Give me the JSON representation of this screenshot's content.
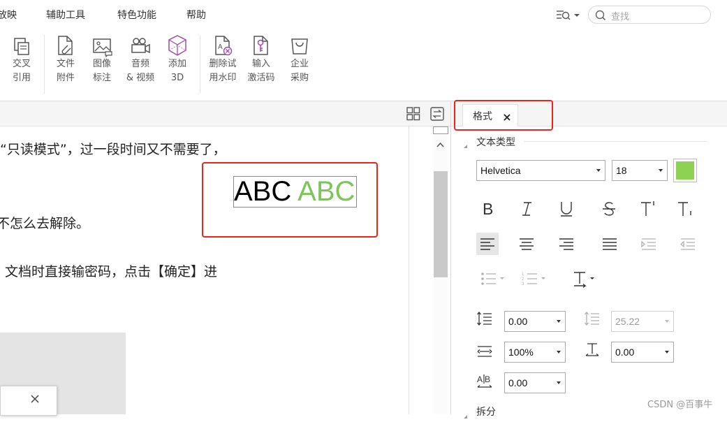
{
  "menu": {
    "items": [
      "放映",
      "辅助工具",
      "特色功能",
      "帮助"
    ],
    "search_placeholder": "查找"
  },
  "ribbon": {
    "buttons": [
      {
        "line1": "交叉",
        "line2": "引用",
        "icon": "cross-reference-icon"
      },
      {
        "line1": "文件",
        "line2": "附件",
        "icon": "file-attachment-icon"
      },
      {
        "line1": "图像",
        "line2": "标注",
        "icon": "image-annotation-icon"
      },
      {
        "line1": "音频",
        "line2": "& 视频",
        "icon": "audio-video-icon"
      },
      {
        "line1": "添加",
        "line2": "3D",
        "icon": "add-3d-icon"
      },
      {
        "line1": "删除试",
        "line2": "用水印",
        "icon": "remove-watermark-icon"
      },
      {
        "line1": "输入",
        "line2": "激活码",
        "icon": "activation-key-icon"
      },
      {
        "line1": "企业",
        "line2": "采购",
        "icon": "enterprise-purchase-icon"
      }
    ]
  },
  "document": {
    "lines": [
      "“只读模式”，过一段时间又不需要了，",
      "不怎么去解除。",
      "文档时直接输密码，点击【确定】进"
    ],
    "sample_black": "ABC",
    "sample_green": "ABC",
    "sample_green_color": "#7dc55a"
  },
  "panel": {
    "tab_label": "格式",
    "section_title": "文本类型",
    "font_family": "Helvetica",
    "font_size": "18",
    "text_color": "#8ed153",
    "line_spacing": "0.00",
    "line_height": "25.22",
    "char_scale": "100%",
    "baseline_offset": "0.00",
    "char_spacing": "0.00",
    "next_section": "拆分"
  },
  "watermark": "CSDN @百事牛"
}
